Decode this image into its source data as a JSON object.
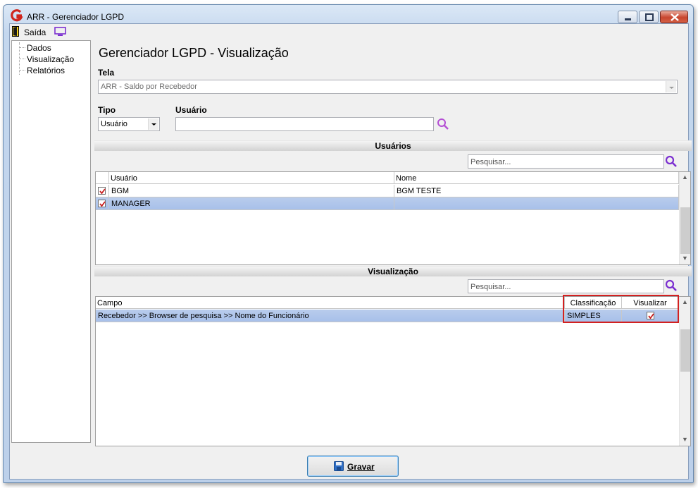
{
  "window": {
    "title": "ARR - Gerenciador LGPD"
  },
  "toolbar": {
    "exit_label": "Saída"
  },
  "tree": {
    "items": [
      "Dados",
      "Visualização",
      "Relatórios"
    ]
  },
  "page": {
    "title": "Gerenciador LGPD - Visualização"
  },
  "form": {
    "tela_label": "Tela",
    "tela_value": "ARR - Saldo por Recebedor",
    "tipo_label": "Tipo",
    "tipo_value": "Usuário",
    "usuario_label": "Usuário",
    "usuario_value": ""
  },
  "usuarios": {
    "section_title": "Usuários",
    "search_placeholder": "Pesquisar...",
    "columns": [
      "Usuário",
      "Nome"
    ],
    "rows": [
      {
        "checked": true,
        "usuario": "BGM",
        "nome": "BGM TESTE",
        "selected": false
      },
      {
        "checked": true,
        "usuario": "MANAGER",
        "nome": "",
        "selected": true
      }
    ]
  },
  "visualizacao": {
    "section_title": "Visualização",
    "search_placeholder": "Pesquisar...",
    "columns": [
      "Campo",
      "Classificação",
      "Visualizar"
    ],
    "rows": [
      {
        "campo": "Recebedor >> Browser de pesquisa >> Nome do Funcionário",
        "classificacao": "SIMPLES",
        "visualizar": true,
        "selected": true
      }
    ]
  },
  "actions": {
    "save_label": "Gravar"
  },
  "colors": {
    "accent": "#7b2fd0",
    "selection": "#b9ccec",
    "highlight": "#d32020",
    "brand": "#d0251c"
  }
}
